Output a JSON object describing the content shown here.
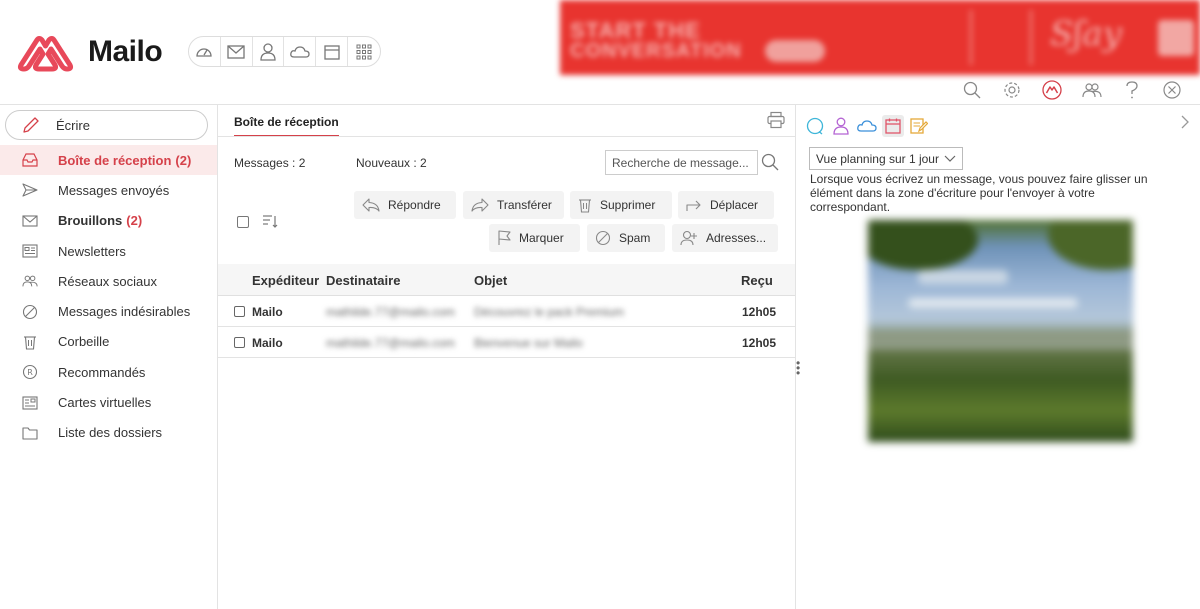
{
  "app": {
    "name": "Mailo",
    "colors": {
      "accent": "#d5414a",
      "logo": "#e8495a",
      "ad": "#e8342f"
    }
  },
  "header": {
    "apps": [
      {
        "name": "dashboard-icon"
      },
      {
        "name": "mail-icon"
      },
      {
        "name": "contacts-icon"
      },
      {
        "name": "cloud-icon"
      },
      {
        "name": "calendar-icon"
      },
      {
        "name": "grid-icon"
      }
    ],
    "ad": {
      "line1": "START THE",
      "line2": "CONVERSATION"
    },
    "tools": [
      "search-icon",
      "gear-icon",
      "mailo-icon",
      "users-icon",
      "help-icon",
      "close-icon"
    ]
  },
  "sidebar": {
    "compose_label": "Écrire",
    "items": [
      {
        "label": "Boîte de réception",
        "count": "(2)",
        "icon": "inbox-icon"
      },
      {
        "label": "Messages envoyés",
        "count": "",
        "icon": "send-icon"
      },
      {
        "label": "Brouillons",
        "count": "(2)",
        "icon": "draft-icon"
      },
      {
        "label": "Newsletters",
        "count": "",
        "icon": "newsletter-icon"
      },
      {
        "label": "Réseaux sociaux",
        "count": "",
        "icon": "social-icon"
      },
      {
        "label": "Messages indésirables",
        "count": "",
        "icon": "spam-icon"
      },
      {
        "label": "Corbeille",
        "count": "",
        "icon": "trash-icon"
      },
      {
        "label": "Recommandés",
        "count": "",
        "icon": "registered-icon"
      },
      {
        "label": "Cartes virtuelles",
        "count": "",
        "icon": "card-icon"
      },
      {
        "label": "Liste des dossiers",
        "count": "",
        "icon": "folder-icon"
      }
    ]
  },
  "main": {
    "tab": "Boîte de réception",
    "messages_count": "Messages : 2",
    "new_count": "Nouveaux : 2",
    "search_placeholder": "Recherche de message...",
    "actions": {
      "reply": "Répondre",
      "forward": "Transférer",
      "delete": "Supprimer",
      "move": "Déplacer",
      "mark": "Marquer",
      "spam": "Spam",
      "addresses": "Adresses..."
    },
    "columns": {
      "sender": "Expéditeur",
      "recipient": "Destinataire",
      "subject": "Objet",
      "received": "Reçu"
    },
    "rows": [
      {
        "sender": "Mailo",
        "recipient": "mathilde.77@mailo.com",
        "subject": "Découvrez le pack Premium",
        "received": "12h05"
      },
      {
        "sender": "Mailo",
        "recipient": "mathilde.77@mailo.com",
        "subject": "Bienvenue sur Mailo",
        "received": "12h05"
      }
    ]
  },
  "rightpanel": {
    "tabs": [
      "chat-icon",
      "contact-icon",
      "cloud-icon",
      "calendar-icon",
      "notes-icon"
    ],
    "view_select": "Vue planning sur 1 jour",
    "hint": "Lorsque vous écrivez un message, vous pouvez faire glisser un élément dans la zone d'écriture pour l'envoyer à votre correspondant."
  }
}
